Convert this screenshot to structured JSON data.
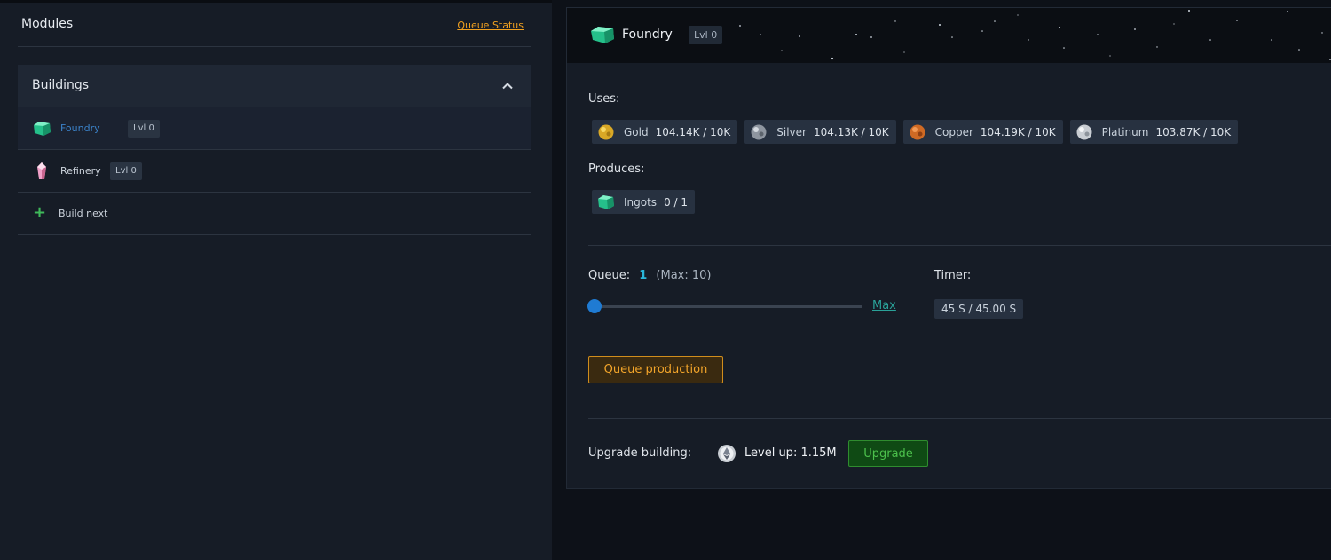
{
  "sidebar": {
    "title": "Modules",
    "queue_status_label": "Queue Status",
    "section_title": "Buildings",
    "items": [
      {
        "name": "Foundry",
        "level": "Lvl 0",
        "icon": "green-gem-icon",
        "active": true
      },
      {
        "name": "Refinery",
        "level": "Lvl 0",
        "icon": "pink-crystal-icon",
        "active": false
      }
    ],
    "build_next_label": "Build next"
  },
  "detail": {
    "title": "Foundry",
    "level": "Lvl 0",
    "uses_label": "Uses:",
    "uses": [
      {
        "name": "Gold",
        "amount": "104.14K / 10K",
        "icon": "gold-ore-icon"
      },
      {
        "name": "Silver",
        "amount": "104.13K / 10K",
        "icon": "silver-ore-icon"
      },
      {
        "name": "Copper",
        "amount": "104.19K / 10K",
        "icon": "copper-ore-icon"
      },
      {
        "name": "Platinum",
        "amount": "103.87K / 10K",
        "icon": "platinum-ore-icon"
      }
    ],
    "produces_label": "Produces:",
    "produces": [
      {
        "name": "Ingots",
        "amount": "0 / 1",
        "icon": "ingot-gem-icon"
      }
    ],
    "queue_label": "Queue:",
    "queue_value": "1",
    "queue_max": "(Max: 10)",
    "queue_fraction": 0.1,
    "max_link": "Max",
    "timer_label": "Timer:",
    "timer_value": "45 S / 45.00 S",
    "queue_button": "Queue production",
    "upgrade_label": "Upgrade building:",
    "levelup_text": "Level up: 1.15M",
    "upgrade_button": "Upgrade"
  },
  "colors": {
    "accent_orange": "#f0a020",
    "accent_blue": "#1f7bd3",
    "accent_green": "#4cc04c",
    "active_link": "#3b82c8"
  }
}
